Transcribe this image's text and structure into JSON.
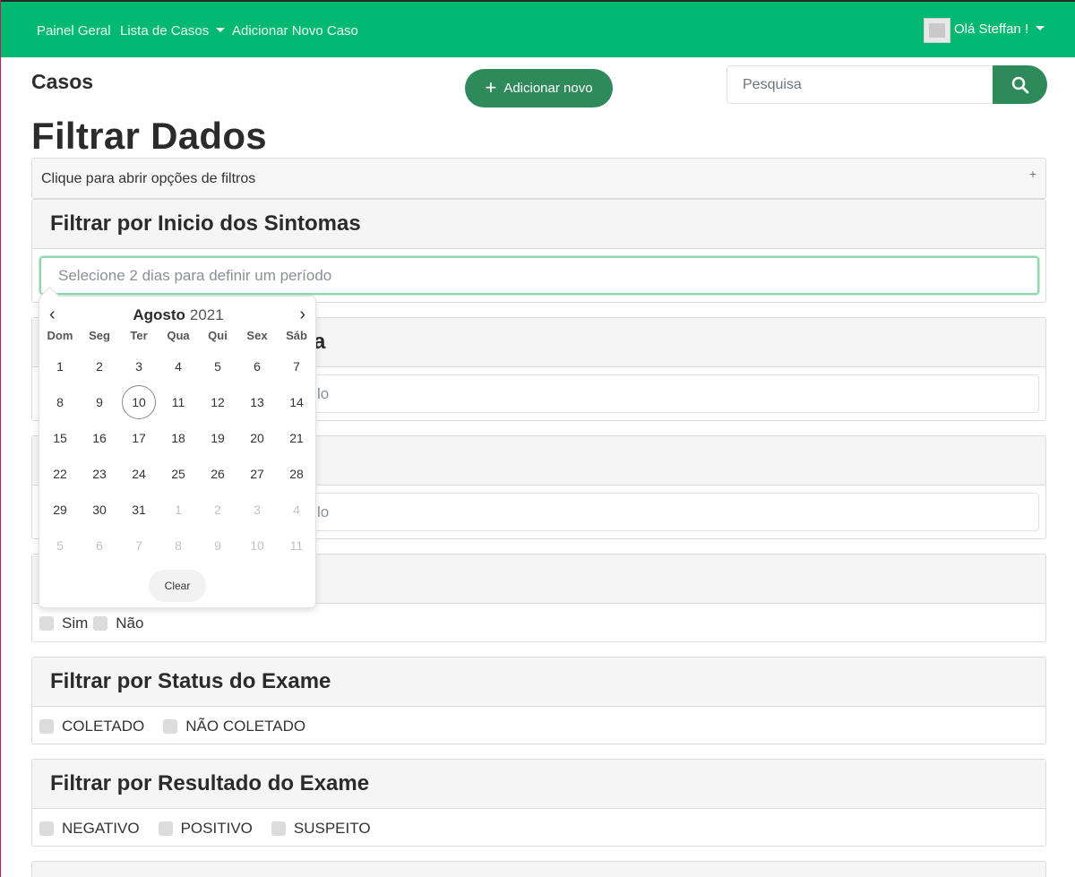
{
  "nav": {
    "links": [
      "Painel Geral",
      "Lista de Casos",
      "Adicionar Novo Caso"
    ],
    "user_label": "Olá Steffan !"
  },
  "header": {
    "section_title": "Casos",
    "add_button_label": "Adicionar novo",
    "search_placeholder": "Pesquisa"
  },
  "page": {
    "title": "Filtrar Dados",
    "collapse_label": "Clique para abrir opções de filtros",
    "collapse_icon": "+"
  },
  "filters": {
    "symptoms": {
      "title": "Filtrar por Inicio dos Sintomas",
      "placeholder": "Selecione 2 dias para definir um período"
    },
    "hidden1": {
      "title_tail": "a",
      "placeholder_tail": "lo"
    },
    "hidden2": {
      "placeholder_tail": "lo"
    },
    "yesno": {
      "options": [
        "Sim",
        "Não"
      ]
    },
    "exam_status": {
      "title": "Filtrar por Status do Exame",
      "options": [
        "COLETADO",
        "NÃO COLETADO"
      ]
    },
    "exam_result": {
      "title": "Filtrar por Resultado do Exame",
      "options": [
        "NEGATIVO",
        "POSITIVO",
        "SUSPEITO"
      ]
    }
  },
  "datepicker": {
    "prev_icon": "‹",
    "next_icon": "›",
    "month": "Agosto",
    "year": "2021",
    "weekdays": [
      "Dom",
      "Seg",
      "Ter",
      "Qua",
      "Qui",
      "Sex",
      "Sáb"
    ],
    "weeks": [
      [
        "1",
        "2",
        "3",
        "4",
        "5",
        "6",
        "7"
      ],
      [
        "8",
        "9",
        "10",
        "11",
        "12",
        "13",
        "14"
      ],
      [
        "15",
        "16",
        "17",
        "18",
        "19",
        "20",
        "21"
      ],
      [
        "22",
        "23",
        "24",
        "25",
        "26",
        "27",
        "28"
      ],
      [
        "29",
        "30",
        "31",
        "1",
        "2",
        "3",
        "4"
      ],
      [
        "5",
        "6",
        "7",
        "8",
        "9",
        "10",
        "11"
      ]
    ],
    "today": "10",
    "clear_label": "Clear"
  }
}
